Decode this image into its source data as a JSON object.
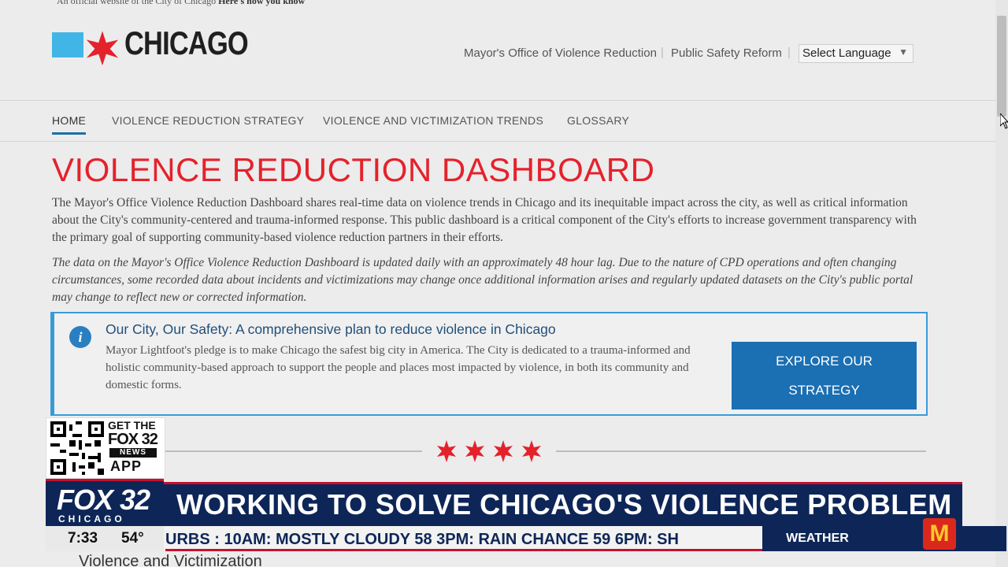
{
  "site": {
    "top_banner": "An official website of the City of Chicago",
    "top_banner_link": "Here's how you know",
    "logo_text": "CHICAGO",
    "util_links": [
      "Mayor's Office of Violence Reduction",
      "Public Safety Reform"
    ],
    "language_select": "Select Language"
  },
  "nav": {
    "items": [
      "HOME",
      "VIOLENCE REDUCTION STRATEGY",
      "VIOLENCE AND VICTIMIZATION TRENDS",
      "GLOSSARY"
    ]
  },
  "main": {
    "title": "VIOLENCE REDUCTION DASHBOARD",
    "intro": "The Mayor's Office Violence Reduction Dashboard shares real-time data on violence trends in Chicago and its inequitable impact across the city, as well as critical information about the City's community-centered and trauma-informed response. This public dashboard is a critical component of the City's efforts to increase government transparency with the primary goal of supporting community-based violence reduction partners in their efforts.",
    "note": "The data on the Mayor's Office Violence Reduction Dashboard is updated daily with an approximately 48 hour lag. Due to the nature of CPD operations and often changing circumstances, some recorded data about incidents and victimizations may change once additional information arises and regularly updated datasets on the City's public portal may change to reflect new or corrected information.",
    "callout": {
      "title": "Our City, Our Safety: A comprehensive plan to reduce violence in Chicago",
      "body": "Mayor Lightfoot's pledge is to make Chicago the safest big city in America. The City is dedicated to a trauma-informed and holistic community-based approach to support the people and places most impacted by violence, in both its community and domestic forms.",
      "button_line1": "EXPLORE OUR",
      "button_line2": "STRATEGY"
    },
    "next_section": "Violence and Victimization"
  },
  "broadcast": {
    "app_promo": {
      "get_the": "GET THE",
      "brand": "FOX 32",
      "news": "NEWS",
      "app": "APP"
    },
    "station": {
      "name": "FOX 32",
      "city": "CHICAGO"
    },
    "headline": "WORKING TO SOLVE CHICAGO'S VIOLENCE PROBLEM",
    "time": "7:33",
    "temp": "54°",
    "ticker": "URBS :   10AM:  MOSTLY  CLOUDY  58     3PM:  RAIN  CHANCE  59  6PM:  SH",
    "weather_label": "WEATHER"
  },
  "colors": {
    "chicago_red": "#e4222c",
    "chicago_blue": "#41b6e6",
    "fox_navy": "#0e2657",
    "button_blue": "#1b6fb3"
  }
}
